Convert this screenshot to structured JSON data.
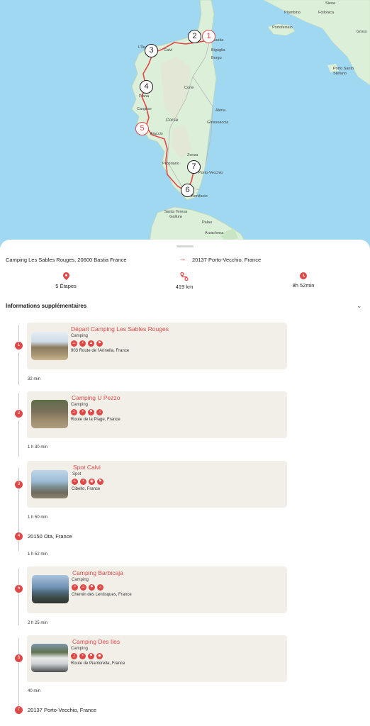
{
  "map": {
    "places": [
      "Piombino",
      "Follonica",
      "Portoferraio",
      "Gross",
      "Porto Santo Stefano",
      "Bastia",
      "Biguglia",
      "Borgo",
      "L'Île",
      "Calvi",
      "Corte",
      "Aléria",
      "Ghisonaccia",
      "Cargèse",
      "Piana",
      "Corse",
      "Ajaccio",
      "Zonza",
      "Propriano",
      "Porto-Vecchio",
      "Bonifacio",
      "Santa Teresa Gallura",
      "Palau",
      "Arzachena",
      "Siena"
    ],
    "markers": [
      "1",
      "2",
      "3",
      "4",
      "5",
      "6",
      "7"
    ]
  },
  "route": {
    "from": "Camping Les Sables Rouges, 20600 Bastia France",
    "to": "20137 Porto-Vecchio, France",
    "arrow": "→"
  },
  "stats": {
    "etapes": "5 Étapes",
    "distance": "419 km",
    "duration": "8h 52min"
  },
  "more_info": {
    "label": "Informations supplémentaires",
    "chevron": "⌄"
  },
  "steps": [
    {
      "num": "1",
      "title": "Départ Camping Les Sables Rouges",
      "type": "Camping",
      "amenities": [
        "♨",
        "⚡",
        "▲",
        "⚑"
      ],
      "address": "903 Route de l'Arinella, France",
      "photo": "beach-hill"
    },
    {
      "num": "2",
      "title": "Camping U Pezzo",
      "type": "Camping",
      "amenities": [
        "♨",
        "⚡",
        "⚑",
        "♫"
      ],
      "address": "Route de la Plage, France",
      "photo": "camp-tents"
    },
    {
      "num": "3",
      "title": "Spot Calvi",
      "type": "Spot",
      "amenities": [
        "♨",
        "⚡",
        "◉",
        "⚑"
      ],
      "address": "Cibello, France",
      "photo": "sea-bench"
    },
    {
      "num": "5",
      "title": "Camping Barbicaja",
      "type": "Camping",
      "amenities": [
        "⚡",
        "♨",
        "⚑",
        "♫"
      ],
      "address": "Chemin des Lentisques, France",
      "photo": "sea-view"
    },
    {
      "num": "6",
      "title": "Camping Des Iles",
      "type": "Camping",
      "amenities": [
        "♫",
        "⚡",
        "⚑",
        "◉"
      ],
      "address": "Route de Piantorella, France",
      "photo": "campervan"
    }
  ],
  "stops": [
    {
      "num": "4",
      "label": "20150 Ota, France"
    },
    {
      "num": "7",
      "label": "20137 Porto-Vecchio, France"
    }
  ],
  "durations": [
    "32 min",
    "1 h 30 min",
    "1 h 50 min",
    "1 h 52 min",
    "2 h 25 min",
    "40 min"
  ],
  "colors": {
    "accent": "#e04848",
    "card": "#f2efe9",
    "sea": "#9fd8f0",
    "land": "#dcefd9"
  },
  "icons": {
    "etapes": "pin-icon",
    "distance": "route-icon",
    "duration": "clock-icon"
  }
}
